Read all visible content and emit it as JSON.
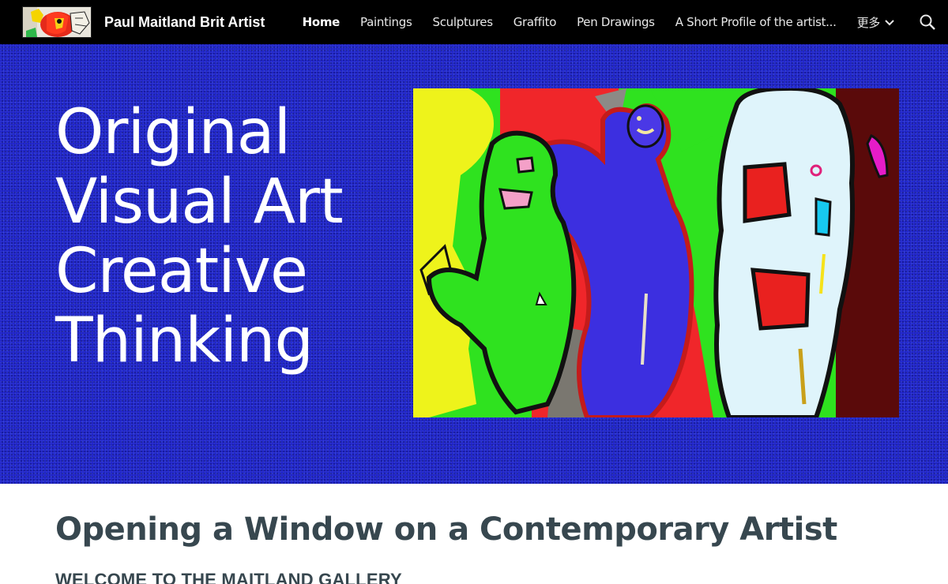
{
  "site": {
    "title": "Paul Maitland Brit Artist"
  },
  "nav": {
    "items": [
      {
        "label": "Home",
        "active": true
      },
      {
        "label": "Paintings",
        "active": false
      },
      {
        "label": "Sculptures",
        "active": false
      },
      {
        "label": "Graffito",
        "active": false
      },
      {
        "label": "Pen Drawings",
        "active": false
      },
      {
        "label": "A Short Profile of the artist...",
        "active": false
      }
    ],
    "more_label": "更多",
    "more_icon": "chevron-down-icon",
    "search_icon": "search-icon"
  },
  "hero": {
    "heading_lines": [
      "Original",
      "Visual Art",
      "Creative",
      "Thinking"
    ],
    "background_color": "#1a1fc9",
    "image_icon": "abstract-painting-image"
  },
  "content": {
    "section_heading": "Opening a Window on a Contemporary Artist",
    "welcome_text": "WELCOME TO THE MAITLAND GALLERY"
  },
  "colors": {
    "topbar": "#000000",
    "hero_blue": "#1a1fc9",
    "heading_text": "#37474f"
  }
}
